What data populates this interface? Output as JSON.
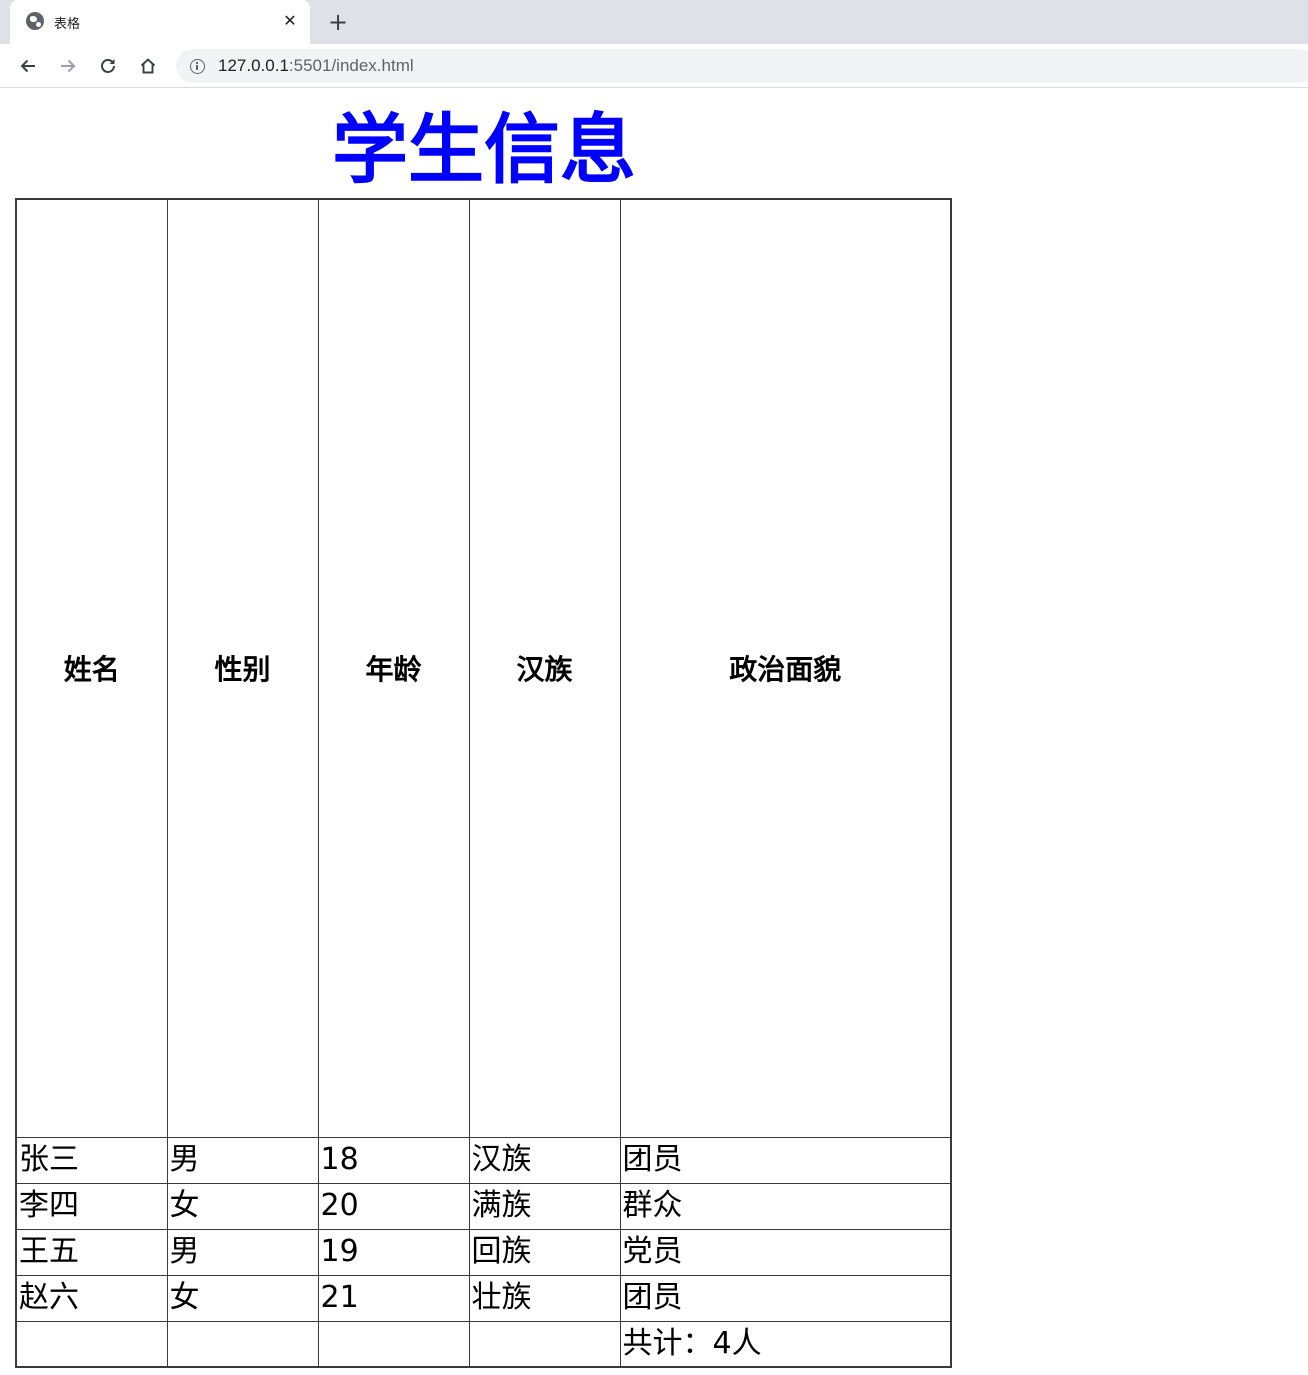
{
  "browser": {
    "tab_title": "表格",
    "url_host": "127.0.0.1",
    "url_rest": ":5501/index.html"
  },
  "page": {
    "title": "学生信息",
    "title_color": "#0000ff"
  },
  "table": {
    "headers": [
      "姓名",
      "性别",
      "年龄",
      "汉族",
      "政治面貌"
    ],
    "rows": [
      [
        "张三",
        "男",
        "18",
        "汉族",
        "团员"
      ],
      [
        "李四",
        "女",
        "20",
        "满族",
        "群众"
      ],
      [
        "王五",
        "男",
        "19",
        "回族",
        "党员"
      ],
      [
        "赵六",
        "女",
        "21",
        "壮族",
        "团员"
      ]
    ],
    "footer": [
      "",
      "",
      "",
      "",
      "共计：4人"
    ]
  }
}
